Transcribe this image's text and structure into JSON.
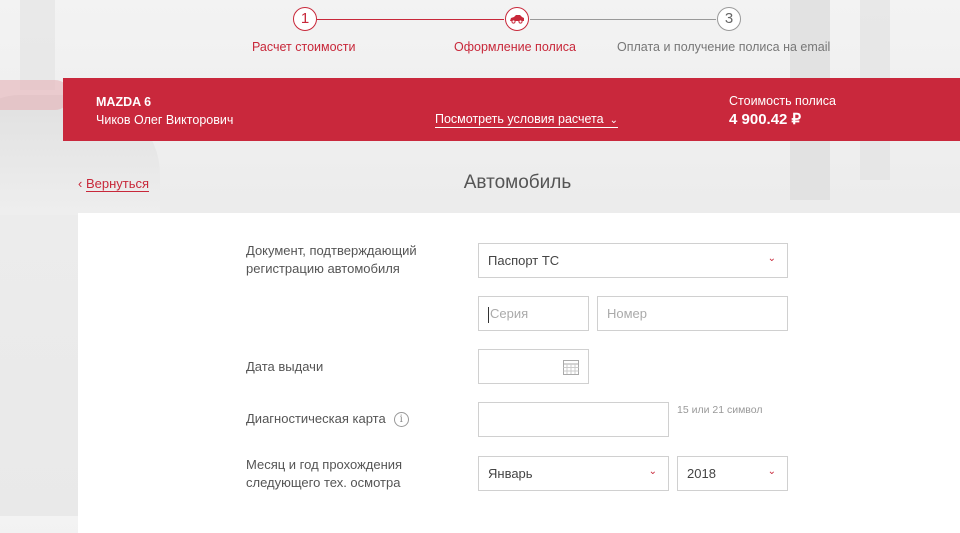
{
  "stepper": {
    "steps": [
      {
        "number": "1",
        "label": "Расчет стоимости"
      },
      {
        "number": "",
        "label": "Оформление полиса",
        "icon": "car-icon"
      },
      {
        "number": "3",
        "label": "Оплата и получение полиса на email"
      }
    ]
  },
  "banner": {
    "car": "MAZDA 6",
    "owner": "Чиков Олег Викторович",
    "terms_link": "Посмотреть условия расчета",
    "price_label": "Стоимость полиса",
    "price": "4 900.42 ₽"
  },
  "nav": {
    "back": "Вернуться",
    "title": "Автомобиль"
  },
  "form": {
    "doc_label": "Документ, подтверждающий регистрацию автомобиля",
    "doc_value": "Паспорт ТС",
    "series_placeholder": "Серия",
    "number_placeholder": "Номер",
    "issue_date_label": "Дата выдачи",
    "diag_label": "Диагностическая карта",
    "diag_hint": "15 или 21 символ",
    "inspection_label": "Месяц и год прохождения следующего тех. осмотра",
    "month_value": "Январь",
    "year_value": "2018"
  },
  "colors": {
    "accent": "#c9283c"
  }
}
